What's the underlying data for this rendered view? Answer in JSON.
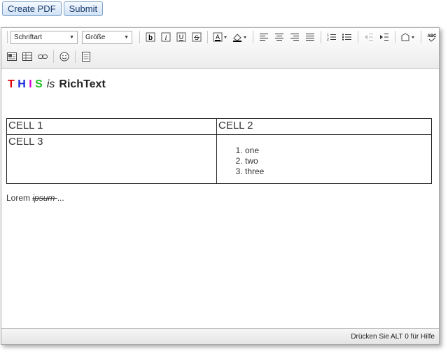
{
  "buttons": {
    "create_pdf": "Create PDF",
    "submit": "Submit"
  },
  "toolbar": {
    "font_select": "Schriftart",
    "size_select": "Größe",
    "icons": [
      "bold-icon",
      "italic-icon",
      "underline-icon",
      "strikethrough-icon",
      "font-color-icon",
      "highlight-color-icon",
      "align-left-icon",
      "align-center-icon",
      "align-right-icon",
      "justify-icon",
      "ordered-list-icon",
      "unordered-list-icon",
      "outdent-icon",
      "indent-icon",
      "paragraph-format-icon",
      "spellcheck-icon",
      "image-icon",
      "table-icon",
      "link-icon",
      "emoji-icon",
      "source-icon"
    ]
  },
  "content": {
    "heading": {
      "letters": [
        "T",
        "H",
        "I",
        "S"
      ],
      "colors": [
        "#e00000",
        "#1a2ad8",
        "#d000d0",
        "#20c020"
      ],
      "is": "is",
      "rest": "RichText"
    },
    "table": {
      "rows": [
        [
          "CELL 1",
          "CELL 2"
        ],
        [
          "CELL 3",
          ""
        ]
      ],
      "list": [
        "one",
        "two",
        "three"
      ]
    },
    "lorem": {
      "plain": "Lorem ",
      "struck": "ipsum ",
      "end": "..."
    }
  },
  "status": {
    "text": "Drücken Sie ALT 0 für Hilfe"
  }
}
